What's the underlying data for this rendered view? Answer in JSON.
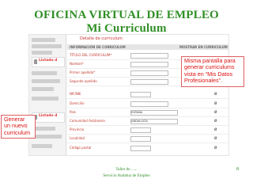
{
  "slide": {
    "title_line1": "OFICINA VIRTUAL DE EMPLEO",
    "title_line2": "Mi Curriculum",
    "callout_right": "Misma pantalla para generar curriculums vista en “Mis Datos Profesionales”.",
    "callout_left": "Generar un nuevo curriculum",
    "footer_line1": "Taller de ......",
    "footer_line2": "Servicio Andaluz de Empleo",
    "page_number": "8"
  },
  "screen": {
    "title": "Detalle de curriculum",
    "left_badges": [
      "Listado d",
      "Listado d"
    ],
    "header_left": "INFORMACIÓN DE CURRICULUM",
    "header_right": "MOSTRAR EN CURRICULUM",
    "fields": [
      {
        "label": "TÍTULO DEL CURRICULUM*",
        "value": "",
        "mark": ""
      },
      {
        "label": "Nombre*",
        "value": "",
        "mark": "Ø"
      },
      {
        "label": "Primer apellido*",
        "value": "",
        "mark": "Ø"
      },
      {
        "label": "Segundo apellido",
        "value": "",
        "mark": "Ø"
      },
      {
        "label": "NIF/NIE",
        "value": "",
        "mark": "Ø"
      },
      {
        "label": "Domicilio",
        "value": "",
        "mark": "Ø"
      },
      {
        "label": "País",
        "value": "ESPAÑA",
        "mark": "Ø"
      },
      {
        "label": "Comunidad Autónoma",
        "value": "ANDALUCÍA",
        "mark": "Ø"
      },
      {
        "label": "Provincia",
        "value": "",
        "mark": "Ø"
      },
      {
        "label": "Localidad",
        "value": "",
        "mark": "Ø"
      },
      {
        "label": "Código postal",
        "value": "",
        "mark": "Ø"
      }
    ]
  }
}
